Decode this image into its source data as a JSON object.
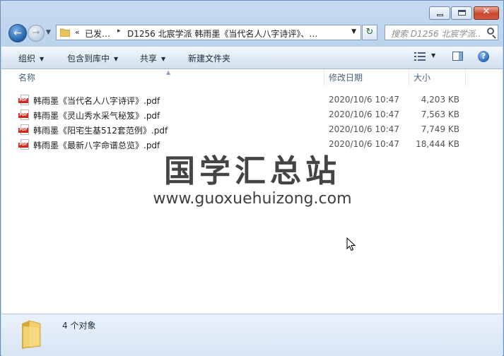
{
  "window": {
    "title_controls": {
      "minimize": "minimize",
      "maximize": "maximize",
      "close": "✕"
    }
  },
  "nav": {
    "back_glyph": "←",
    "forward_glyph": "→",
    "refresh_glyph": "↻",
    "breadcrumb": [
      "已发…",
      "D1256 北宸学派 韩雨墨《当代名人八字诗评》、…"
    ],
    "breadcrumb_prefix": "«",
    "search_placeholder": "搜索 D1256 北宸学派..."
  },
  "toolbar": {
    "organize": "组织",
    "include_in_library": "包含到库中",
    "share": "共享",
    "new_folder": "新建文件夹"
  },
  "columns": {
    "name": "名称",
    "modified": "修改日期",
    "size": "大小"
  },
  "files": [
    {
      "name": "韩雨墨《当代名人八字诗评》.pdf",
      "modified": "2020/10/6 10:47",
      "size": "4,203 KB"
    },
    {
      "name": "韩雨墨《灵山秀水采气秘笈》.pdf",
      "modified": "2020/10/6 10:47",
      "size": "7,563 KB"
    },
    {
      "name": "韩雨墨《阳宅生基512套范例》.pdf",
      "modified": "2020/10/6 10:47",
      "size": "7,749 KB"
    },
    {
      "name": "韩雨墨《最新八字命谱总览》.pdf",
      "modified": "2020/10/6 10:47",
      "size": "18,444 KB"
    }
  ],
  "watermark": {
    "title": "国学汇总站",
    "url": "www.guoxuehuizong.com"
  },
  "status": {
    "count": "4 个对象"
  },
  "icons": {
    "pdf": "pdf-icon",
    "folder": "folder-icon",
    "search": "search-icon",
    "help": "help-icon"
  },
  "colors": {
    "pdf_red": "#d4261c",
    "window_blue": "#c6dbf1",
    "close_red": "#c7472d"
  }
}
